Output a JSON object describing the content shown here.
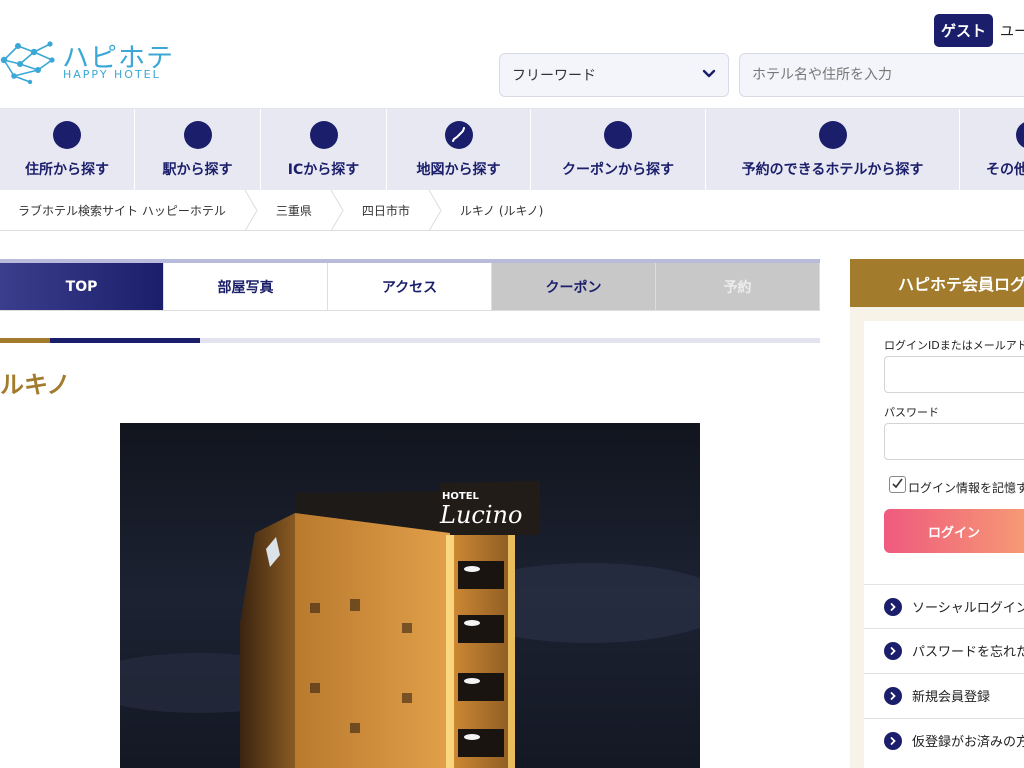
{
  "header": {
    "logo_jp": "ハピホテ",
    "logo_en": "HAPPY HOTEL",
    "guest_label": "ゲスト",
    "user_text": "ユー",
    "search_type": "フリーワード",
    "search_placeholder": "ホテル名や住所を入力"
  },
  "nav": [
    {
      "label": "住所から探す",
      "icon": "circle"
    },
    {
      "label": "駅から探す",
      "icon": "circle"
    },
    {
      "label": "ICから探す",
      "icon": "circle"
    },
    {
      "label": "地図から探す",
      "icon": "japan-map-icon"
    },
    {
      "label": "クーポンから探す",
      "icon": "circle"
    },
    {
      "label": "予約のできるホテルから探す",
      "icon": "circle"
    },
    {
      "label": "その他",
      "icon": "circle"
    }
  ],
  "breadcrumb": [
    "ラブホテル検索サイト ハッピーホテル",
    "三重県",
    "四日市市",
    "ルキノ (ルキノ)"
  ],
  "tabs": [
    "TOP",
    "部屋写真",
    "アクセス",
    "クーポン",
    "予約"
  ],
  "hotel": {
    "name": "ルキノ",
    "sign_top": "HOTEL",
    "sign_script": "Lucino"
  },
  "login": {
    "title": "ハピホテ会員ログ",
    "id_label": "ログインIDまたはメールアドレ",
    "password_label": "パスワード",
    "remember_label": "ログイン情報を記憶す",
    "button_label": "ログイン",
    "links": [
      "ソーシャルログイン",
      "パスワードを忘れた方",
      "新規会員登録",
      "仮登録がお済みの方"
    ]
  },
  "colors": {
    "navy": "#1b1f6b",
    "gold": "#a27c2c",
    "logo_blue": "#3aa7d6",
    "nav_bg": "#e8e8f2"
  }
}
